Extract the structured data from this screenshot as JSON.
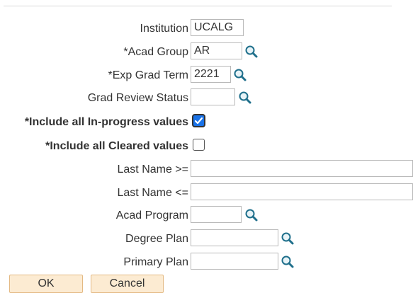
{
  "form": {
    "institution": {
      "label": "Institution",
      "value": "UCALG"
    },
    "acad_group": {
      "label": "*Acad Group",
      "value": "AR"
    },
    "exp_grad_term": {
      "label": "*Exp Grad Term",
      "value": "2221"
    },
    "grad_review_status": {
      "label": "Grad Review Status",
      "value": ""
    },
    "include_in_progress": {
      "label": "*Include all In-progress values",
      "checked": true
    },
    "include_cleared": {
      "label": "*Include all Cleared values",
      "checked": false
    },
    "last_name_from": {
      "label": "Last Name >=",
      "value": ""
    },
    "last_name_to": {
      "label": "Last Name <=",
      "value": ""
    },
    "acad_program": {
      "label": "Acad Program",
      "value": ""
    },
    "degree_plan": {
      "label": "Degree Plan",
      "value": ""
    },
    "primary_plan": {
      "label": "Primary Plan",
      "value": ""
    }
  },
  "buttons": {
    "ok": "OK",
    "cancel": "Cancel"
  },
  "icons": {
    "lookup": "magnifier-icon",
    "checkmark": "checkmark-icon"
  },
  "colors": {
    "checkbox_checked": "#1a73e8",
    "button_bg": "#fcebd2",
    "icon": "#1f6f8b"
  }
}
